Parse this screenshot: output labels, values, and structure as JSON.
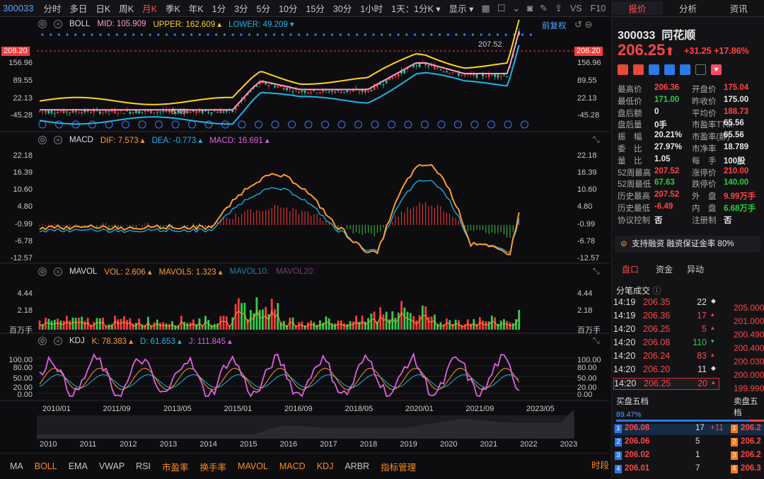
{
  "toolbar": {
    "code": "300033",
    "periods": [
      "分时",
      "多日",
      "日K",
      "周K",
      "月K",
      "季K",
      "年K",
      "1分",
      "3分",
      "5分",
      "10分",
      "15分",
      "30分",
      "1小时"
    ],
    "active": "月K",
    "dropdown1": "1天：1分K",
    "display": "显示",
    "vs": "VS",
    "f10": "F10"
  },
  "boll": {
    "name": "BOLL",
    "mid_label": "MID:",
    "mid": "105.909",
    "upper_label": "UPPER:",
    "upper": "162.609",
    "lower_label": "LOWER:",
    "lower": "49.209",
    "fq": "前复权",
    "yaxis": [
      "207.52",
      "156.96",
      "89.55",
      "22.13",
      "-45.28"
    ],
    "cur": "206.20",
    "hi_label": "207.52",
    "lo_label": "-6.49"
  },
  "macd": {
    "name": "MACD",
    "dif_label": "DIF:",
    "dif": "7.573",
    "dea_label": "DEA:",
    "dea": "-0.773",
    "macd_label": "MACD:",
    "macd": "16.691",
    "yaxis": [
      "22.18",
      "16.39",
      "10.60",
      "4.80",
      "-0.99",
      "-6.78",
      "-12.57"
    ]
  },
  "mavol": {
    "name": "MAVOL",
    "vol_label": "VOL:",
    "vol": "2.606",
    "m5_label": "MAVOL5:",
    "m5": "1.323",
    "m10": "MAVOL10:",
    "m20": "MAVOL20:",
    "yaxis": [
      "4.44",
      "2.18"
    ],
    "unit": "百万手"
  },
  "kdj": {
    "name": "KDJ",
    "k_label": "K:",
    "k": "78.383",
    "d_label": "D:",
    "d": "61.653",
    "j_label": "J:",
    "j": "111.845",
    "yaxis": [
      "100.00",
      "80.00",
      "50.00",
      "20.00",
      "0.00"
    ]
  },
  "xaxis": [
    "2010/01",
    "2011/09",
    "2013/05",
    "2015/01",
    "2016/09",
    "2018/05",
    "2020/01",
    "2021/09",
    "2023/05"
  ],
  "years": [
    "2010",
    "2011",
    "2012",
    "2013",
    "2014",
    "2015",
    "2016",
    "2017",
    "2018",
    "2019",
    "2020",
    "2021",
    "2022",
    "2023"
  ],
  "bottom": [
    "MA",
    "BOLL",
    "EMA",
    "VWAP",
    "RSI",
    "市盈率",
    "换手率",
    "MAVOL",
    "MACD",
    "KDJ",
    "ARBR",
    "指标管理"
  ],
  "bottom_right": "时段",
  "right": {
    "tabs": [
      "报价",
      "分析",
      "资讯"
    ],
    "code": "300033",
    "name": "同花顺",
    "price": "206.25",
    "chg": "+31.25",
    "pct": "+17.86%",
    "quote": [
      [
        "最高价",
        "206.36",
        "red",
        "开盘价",
        "175.04",
        "red"
      ],
      [
        "最低价",
        "171.00",
        "green",
        "昨收价",
        "175.00",
        "white"
      ],
      [
        "盘后额",
        "0",
        "white",
        "平均价",
        "188.73",
        "red"
      ],
      [
        "盘后量",
        "0手",
        "white",
        "市盈率TTM",
        "65.56",
        "white"
      ],
      [
        "振　幅",
        "20.21%",
        "white",
        "市盈率(静)",
        "65.56",
        "white"
      ],
      [
        "委　比",
        "27.97%",
        "white",
        "市净率",
        "18.789",
        "white"
      ],
      [
        "量　比",
        "1.05",
        "white",
        "每　手",
        "100股",
        "white"
      ],
      [
        "52周最高",
        "207.52",
        "red",
        "涨停价",
        "210.00",
        "red"
      ],
      [
        "52周最低",
        "67.63",
        "green",
        "跌停价",
        "140.00",
        "green"
      ],
      [
        "历史最高",
        "207.52",
        "red",
        "外　盘",
        "9.99万手",
        "red"
      ],
      [
        "历史最低",
        "-6.49",
        "red",
        "内　盘",
        "6.68万手",
        "green"
      ],
      [
        "协议控制",
        "否",
        "white",
        "注册制",
        "否",
        "white"
      ]
    ],
    "margin": "支持融资 融资保证金率 80%",
    "subtabs": [
      "盘口",
      "资金",
      "异动"
    ],
    "ticks_title": "分笔成交",
    "ticks": [
      [
        "14:19",
        "206.35",
        "22",
        "white"
      ],
      [
        "14:19",
        "206.36",
        "17",
        "red"
      ],
      [
        "14:20",
        "206.25",
        "5",
        "red"
      ],
      [
        "14:20",
        "206.08",
        "110",
        "green"
      ],
      [
        "14:20",
        "206.24",
        "83",
        "red"
      ],
      [
        "14:20",
        "206.20",
        "11",
        "white"
      ],
      [
        "14:20",
        "206.25",
        "20",
        "red"
      ]
    ],
    "side_prices": [
      "205.000",
      "201.000",
      "200.490",
      "200.400",
      "200.030",
      "200.000",
      "199.990"
    ],
    "buy5": "买盘五档",
    "sell5": "卖盘五档",
    "ratio": "89.47%",
    "bids": [
      [
        "1",
        "206.08",
        "17",
        "+11"
      ],
      [
        "2",
        "206.06",
        "5",
        ""
      ],
      [
        "3",
        "206.02",
        "1",
        ""
      ],
      [
        "4",
        "206.01",
        "7",
        ""
      ]
    ],
    "asks": [
      "206.2",
      "206.2",
      "206.2",
      "206.3"
    ]
  },
  "colors": {
    "up": "#ff3b3b",
    "down": "#2ecc40",
    "orange": "#ff9a2e",
    "yellow": "#ffd21f",
    "pink": "#ff9ec8",
    "cyan": "#1fb5e8",
    "magenta": "#e060e0"
  }
}
